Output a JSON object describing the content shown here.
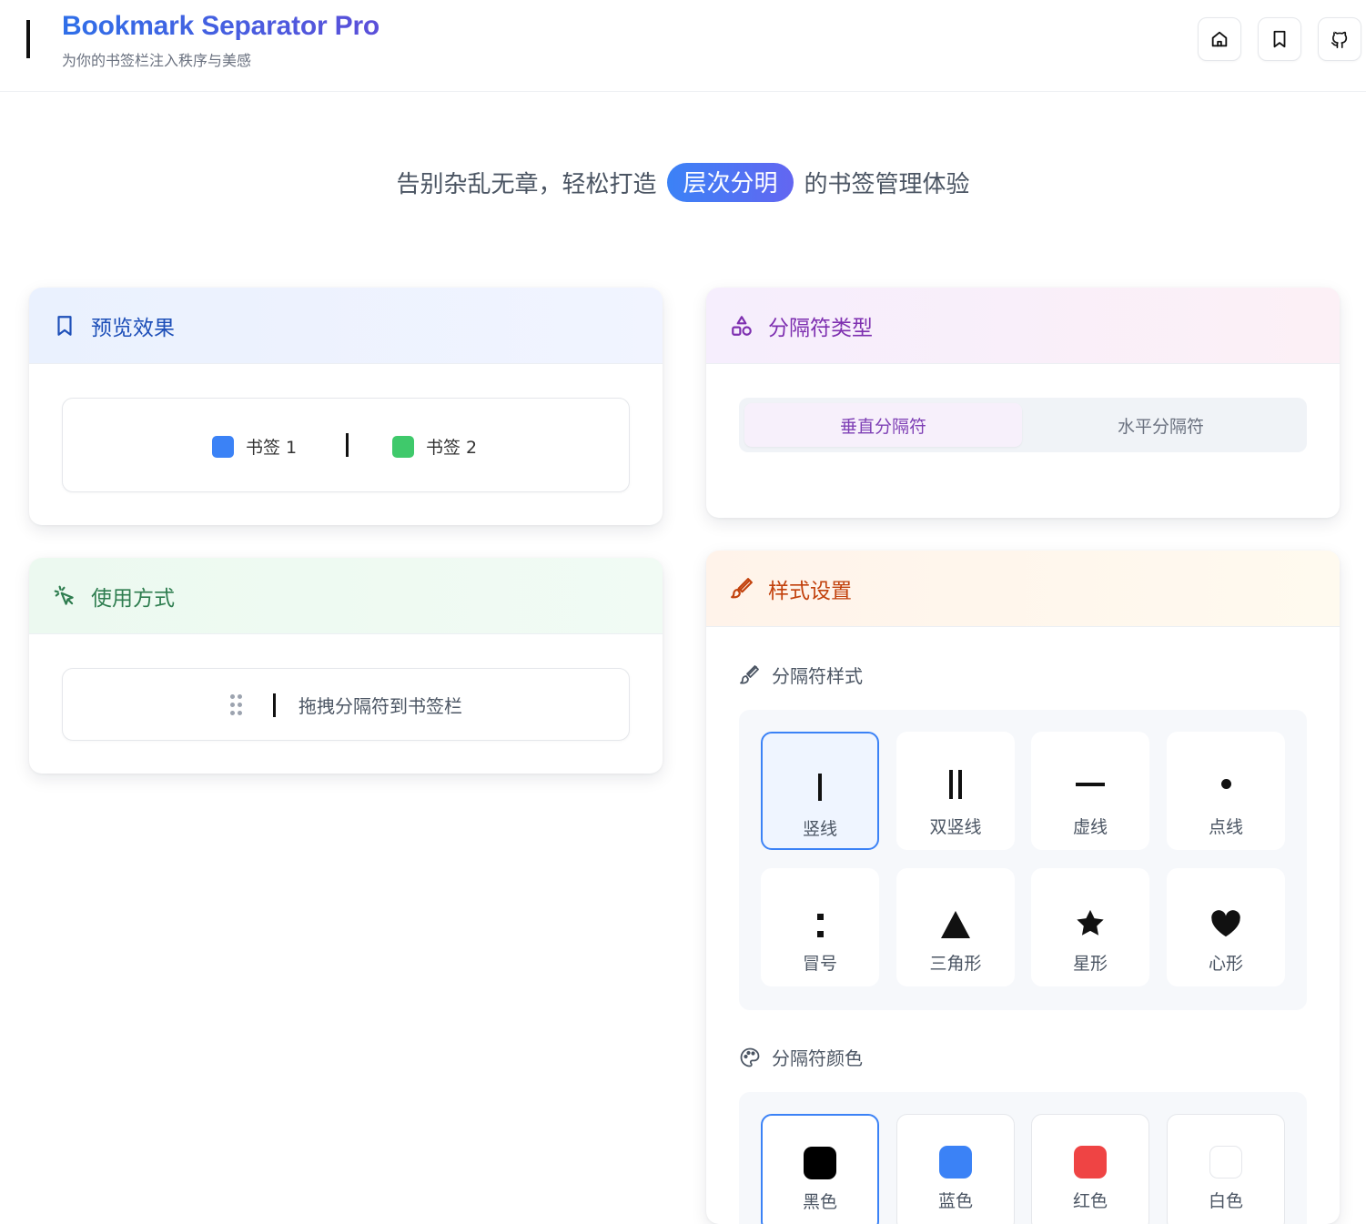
{
  "header": {
    "title": "Bookmark Separator Pro",
    "subtitle": "为你的书签栏注入秩序与美感",
    "buttons": [
      {
        "icon": "home-icon"
      },
      {
        "icon": "bookmark-icon"
      },
      {
        "icon": "github-icon"
      }
    ]
  },
  "hero": {
    "before": "告别杂乱无章，轻松打造",
    "highlight": "层次分明",
    "after": "的书签管理体验"
  },
  "preview": {
    "title": "预览效果",
    "bookmark1": "书签 1",
    "bookmark2": "书签 2",
    "bookmark1_color": "#3b82f6",
    "bookmark2_color": "#3fc96b"
  },
  "usage": {
    "title": "使用方式",
    "instruction": "拖拽分隔符到书签栏"
  },
  "separator_type": {
    "title": "分隔符类型",
    "options": [
      "垂直分隔符",
      "水平分隔符"
    ],
    "selected": "垂直分隔符"
  },
  "style_settings": {
    "title": "样式设置",
    "style_label": "分隔符样式",
    "styles": [
      {
        "label": "竖线",
        "selected": true
      },
      {
        "label": "双竖线",
        "selected": false
      },
      {
        "label": "虚线",
        "selected": false
      },
      {
        "label": "点线",
        "selected": false
      },
      {
        "label": "冒号",
        "selected": false
      },
      {
        "label": "三角形",
        "selected": false
      },
      {
        "label": "星形",
        "selected": false
      },
      {
        "label": "心形",
        "selected": false
      }
    ],
    "color_label": "分隔符颜色",
    "colors": [
      {
        "label": "黑色",
        "value": "#000000",
        "selected": true
      },
      {
        "label": "蓝色",
        "value": "#3b82f6",
        "selected": false
      },
      {
        "label": "红色",
        "value": "#ef4444",
        "selected": false
      },
      {
        "label": "白色",
        "value": "#ffffff",
        "selected": false
      }
    ]
  },
  "colors": {
    "accent_blue": "#3b82f6",
    "accent_purple": "#7e3fb5",
    "accent_green": "#2e7d4f",
    "accent_orange": "#c2410c"
  }
}
